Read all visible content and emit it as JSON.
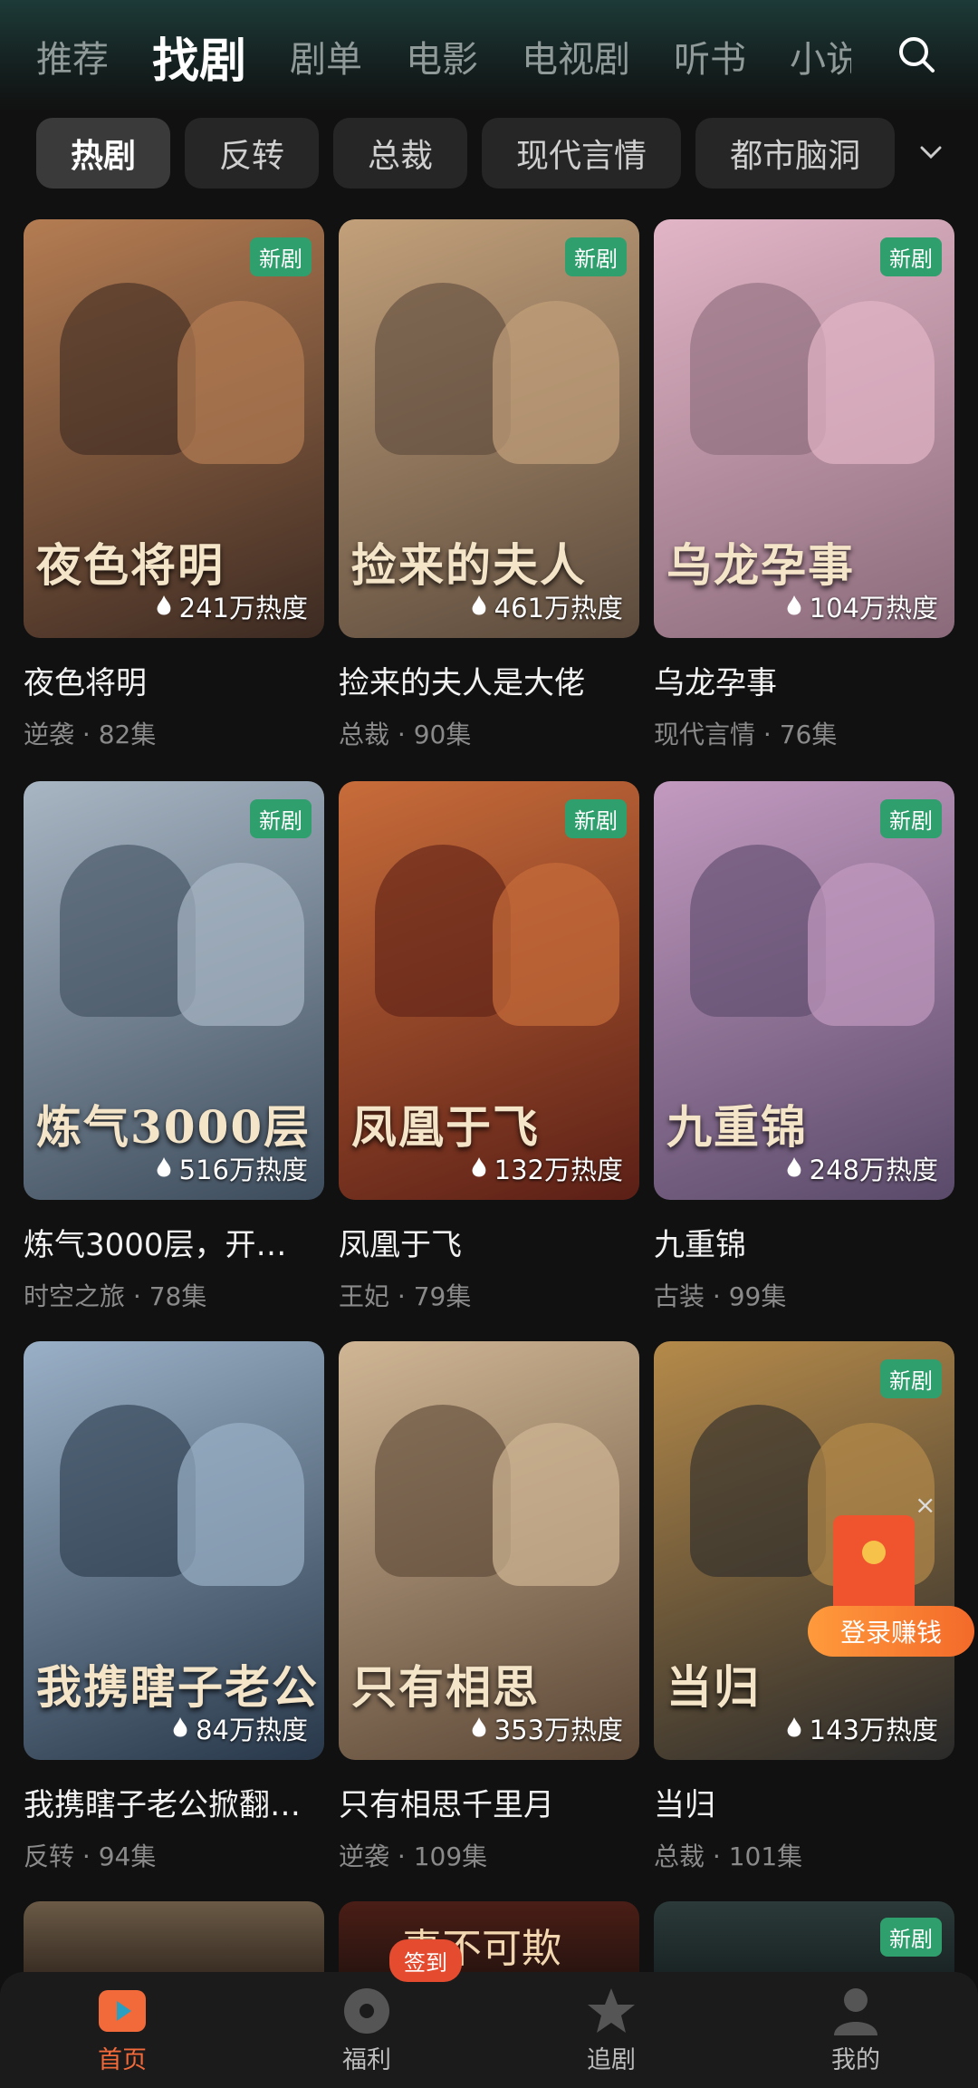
{
  "top_tabs": [
    "推荐",
    "找剧",
    "剧单",
    "电影",
    "电视剧",
    "听书",
    "小说"
  ],
  "active_tab_index": 1,
  "filters": [
    "热剧",
    "反转",
    "总裁",
    "现代言情",
    "都市脑洞"
  ],
  "badge_new": "新剧",
  "cards": [
    {
      "poster_title": "夜色将明",
      "name": "夜色将明",
      "heat": "241万热度",
      "meta": "逆袭 · 82集",
      "is_new": true,
      "colors": [
        "#3c2a22",
        "#b47c52"
      ]
    },
    {
      "poster_title": "捡来的夫人",
      "name": "捡来的夫人是大佬",
      "heat": "461万热度",
      "meta": "总裁 · 90集",
      "is_new": true,
      "colors": [
        "#5b4a3c",
        "#c2a07a"
      ]
    },
    {
      "poster_title": "乌龙孕事",
      "name": "乌龙孕事",
      "heat": "104万热度",
      "meta": "现代言情 · 76集",
      "is_new": true,
      "colors": [
        "#8a6a7a",
        "#e2b5c6"
      ]
    },
    {
      "poster_title": "炼气3000层",
      "name": "炼气3000层，开…",
      "heat": "516万热度",
      "meta": "时空之旅 · 78集",
      "is_new": true,
      "colors": [
        "#3d4c5c",
        "#a8b6c4"
      ]
    },
    {
      "poster_title": "凤凰于飞",
      "name": "凤凰于飞",
      "heat": "132万热度",
      "meta": "王妃 · 79集",
      "is_new": true,
      "colors": [
        "#5b1f16",
        "#c86c3a"
      ]
    },
    {
      "poster_title": "九重锦",
      "name": "九重锦",
      "heat": "248万热度",
      "meta": "古装 · 99集",
      "is_new": true,
      "colors": [
        "#5a4a6a",
        "#c39ac0"
      ]
    },
    {
      "poster_title": "我携瞎子老公",
      "name": "我携瞎子老公掀翻…",
      "heat": "84万热度",
      "meta": "反转 · 94集",
      "is_new": false,
      "colors": [
        "#28384a",
        "#9ab0c6"
      ]
    },
    {
      "poster_title": "只有相思",
      "name": "只有相思千里月",
      "heat": "353万热度",
      "meta": "逆袭 · 109集",
      "is_new": false,
      "colors": [
        "#5a4636",
        "#d0b694"
      ]
    },
    {
      "poster_title": "当归",
      "name": "当归",
      "heat": "143万热度",
      "meta": "总裁 · 101集",
      "is_new": true,
      "colors": [
        "#2a2a2a",
        "#b58a4a"
      ]
    }
  ],
  "partial_row_new": true,
  "partial_row_text": "妻不可欺",
  "floating_promo": {
    "button": "登录赚钱",
    "close": "×"
  },
  "bottom_nav": [
    {
      "label": "首页",
      "icon": "home-play-icon",
      "active": true
    },
    {
      "label": "福利",
      "icon": "gift-disc-icon",
      "active": false
    },
    {
      "label": "追剧",
      "icon": "star-icon",
      "active": false
    },
    {
      "label": "我的",
      "icon": "profile-icon",
      "active": false
    }
  ],
  "signin_badge": "签到",
  "colors": {
    "accent": "#f26a3a",
    "new_badge": "#2f9f6d",
    "background": "#111111"
  }
}
